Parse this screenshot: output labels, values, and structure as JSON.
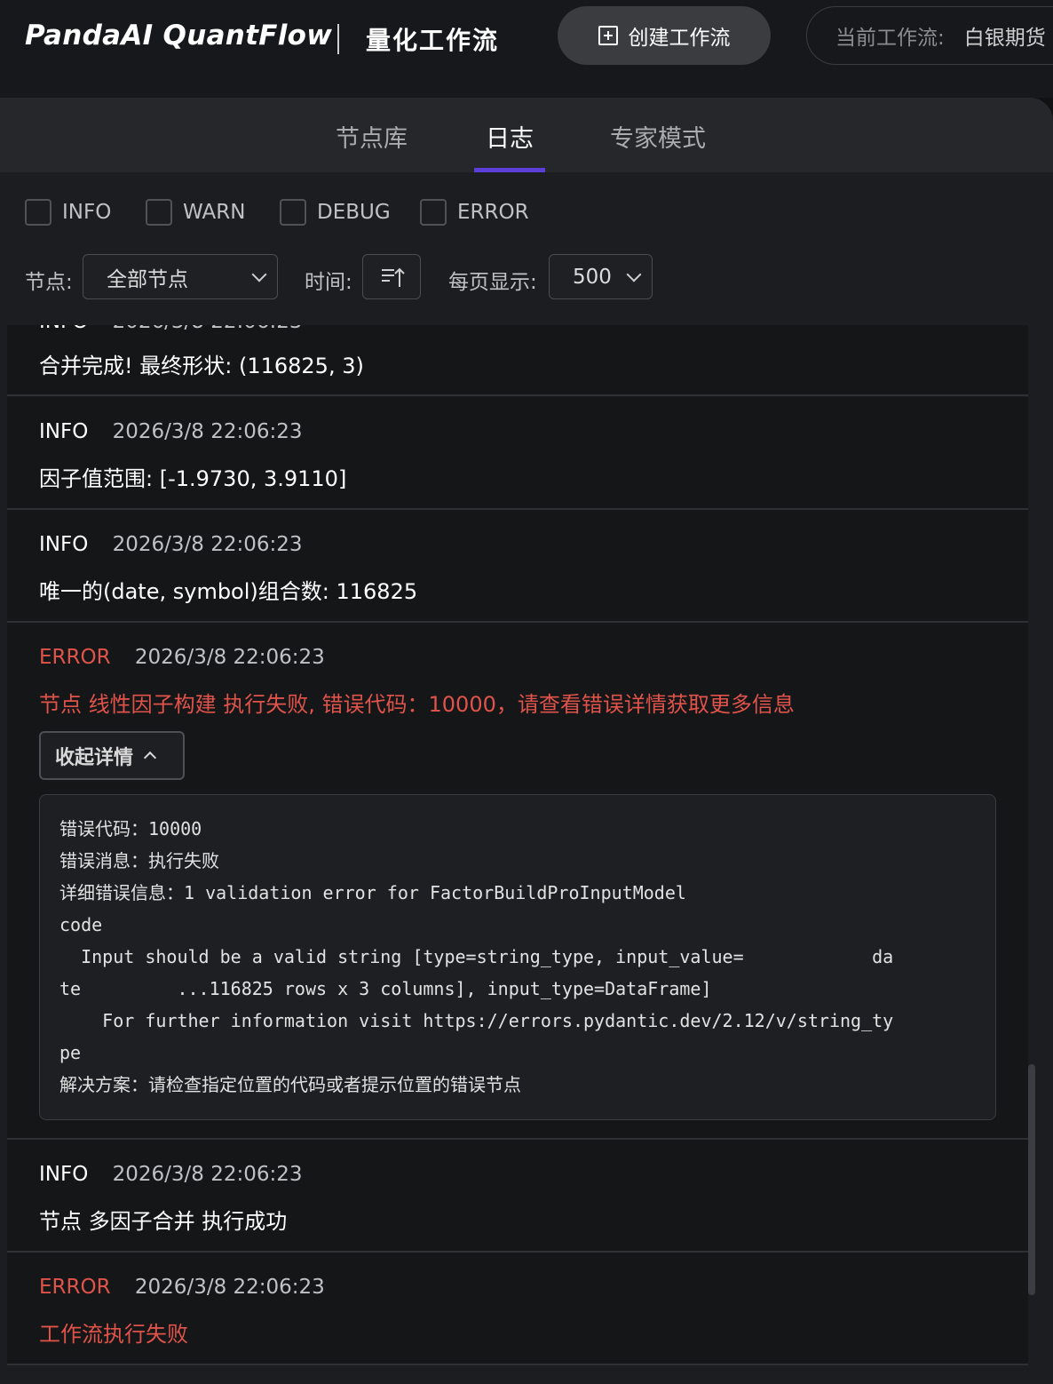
{
  "header": {
    "brand": "PandaAI QuantFlow",
    "subtitle": "量化工作流",
    "create_button": "创建工作流",
    "current_flow_label": "当前工作流:",
    "current_flow_value": "白银期货"
  },
  "tabs": [
    "节点库",
    "日志",
    "专家模式"
  ],
  "active_tab": "日志",
  "filters": {
    "levels": [
      "INFO",
      "WARN",
      "DEBUG",
      "ERROR"
    ],
    "node_label": "节点:",
    "node_value": "全部节点",
    "time_label": "时间:",
    "page_size_label": "每页显示:",
    "page_size_value": "500"
  },
  "logs": [
    {
      "level": "INFO",
      "time": "2026/3/8 22:06:23",
      "message": "合并完成! 最终形状: (116825, 3)"
    },
    {
      "level": "INFO",
      "time": "2026/3/8 22:06:23",
      "message": "因子值范围: [-1.9730, 3.9110]"
    },
    {
      "level": "INFO",
      "time": "2026/3/8 22:06:23",
      "message": "唯一的(date, symbol)组合数: 116825"
    },
    {
      "level": "ERROR",
      "time": "2026/3/8 22:06:23",
      "message": "节点 线性因子构建 执行失败, 错误代码：10000，请查看错误详情获取更多信息",
      "collapse_label": "收起详情",
      "detail": "错误代码：10000\n错误消息：执行失败\n详细错误信息：1 validation error for FactorBuildProInputModel\ncode\n  Input should be a valid string [type=string_type, input_value=            da\nte         ...116825 rows x 3 columns], input_type=DataFrame]\n    For further information visit https://errors.pydantic.dev/2.12/v/string_ty\npe\n解决方案：请检查指定位置的代码或者提示位置的错误节点"
    },
    {
      "level": "INFO",
      "time": "2026/3/8 22:06:23",
      "message": "节点 多因子合并 执行成功"
    },
    {
      "level": "ERROR",
      "time": "2026/3/8 22:06:23",
      "message": "工作流执行失败"
    }
  ]
}
